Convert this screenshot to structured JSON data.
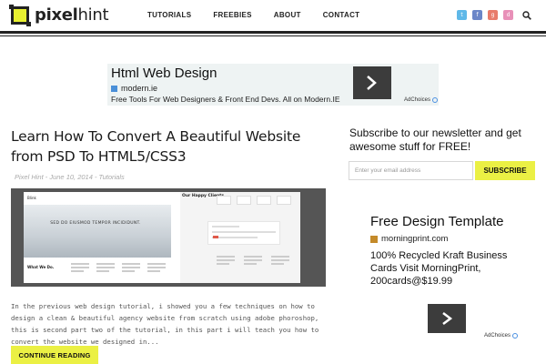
{
  "header": {
    "logo_bold": "pixel",
    "logo_light": "hint",
    "nav": [
      "TUTORIALS",
      "FREEBIES",
      "ABOUT",
      "CONTACT"
    ],
    "social": [
      {
        "name": "twitter-icon",
        "glyph": "t",
        "color": "#5fb8e8"
      },
      {
        "name": "facebook-icon",
        "glyph": "f",
        "color": "#6b86c8"
      },
      {
        "name": "google-plus-icon",
        "glyph": "g",
        "color": "#e87b6a"
      },
      {
        "name": "dribbble-icon",
        "glyph": "d",
        "color": "#e890b8"
      }
    ]
  },
  "ad_top": {
    "title": "Html Web Design",
    "site": "modern.ie",
    "description": "Free Tools For Web Designers & Front End Devs. All on Modern.IE",
    "adchoices": "AdChoices"
  },
  "post": {
    "title": "Learn How To Convert A Beautiful Website from PSD To HTML5/CSS3",
    "meta": "Pixel Hint - June 10, 2014 - Tutorials",
    "thumb": {
      "logo": "Blink",
      "hero_text": "SED DO EIUSMOD TEMPOR INCIDIDUNT.",
      "section": "What We Do.",
      "clients": "Our Happy Clients."
    },
    "excerpt": "In the previous web design tutorial, i showed you a few techniques on how to design a clean & beautiful agency website from scratch using adobe phoroshop, this is second part two of the tutorial, in this part i will teach you how to convert the website we designed in...",
    "continue_label": "CONTINUE READING"
  },
  "sidebar": {
    "subscribe_text": "Subscribe to our newsletter and get awesome stuff for FREE!",
    "email_placeholder": "Enter your email address",
    "subscribe_label": "SUBSCRIBE"
  },
  "ad_side": {
    "title": "Free Design Template",
    "site": "morningprint.com",
    "description": "100% Recycled Kraft Business Cards Visit MorningPrint, 200cards@$19.99",
    "adchoices": "AdChoices"
  },
  "colors": {
    "accent": "#ebf044",
    "dark": "#222222"
  }
}
